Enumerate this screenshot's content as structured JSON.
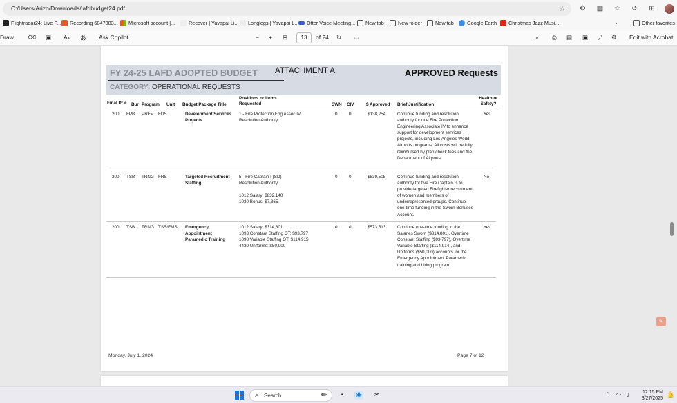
{
  "browser": {
    "url": "C:/Users/Arizo/Downloads/lafdbudget24.pdf",
    "favorites": [
      {
        "label": "Flightradar24: Live F...",
        "color": "#222"
      },
      {
        "label": "Recording 6847083...",
        "color": "#e8562a"
      },
      {
        "label": "Microsoft account |...",
        "color": "#f25022"
      },
      {
        "label": "Recover | Yavapai Li...",
        "color": "#ddd"
      },
      {
        "label": "Longlegs | Yavapai L...",
        "color": "#ddd"
      },
      {
        "label": "Otter Voice Meeting...",
        "color": "#3a5bd9"
      },
      {
        "label": "New tab",
        "color": "#555"
      },
      {
        "label": "New folder",
        "color": "#555"
      },
      {
        "label": "New tab",
        "color": "#555"
      },
      {
        "label": "Google Earth",
        "color": "#3d8ee6"
      },
      {
        "label": "Christmas Jazz Musi...",
        "color": "#e62117"
      }
    ],
    "other_favorites": "Other favorites"
  },
  "pdf_toolbar": {
    "draw": "Draw",
    "ask_copilot": "Ask Copilot",
    "page_current": "13",
    "page_total": "of 24",
    "edit_with_acrobat": "Edit with Acrobat"
  },
  "document": {
    "title": "FY 24-25 LAFD ADOPTED BUDGET",
    "attachment": "ATTACHMENT A",
    "status_heading": "APPROVED Requests",
    "category_label": "CATEGORY:",
    "category_value": "OPERATIONAL REQUESTS",
    "columns": {
      "final_pr": "Final Pr #",
      "bur": "Bur",
      "program": "Program",
      "unit": "Unit",
      "title": "Budget Package Title",
      "positions": "Positions or Items Requested",
      "swn": "SWN",
      "civ": "CIV",
      "approved": "$ Approved",
      "justification": "Brief Justification",
      "health": "Health or Safety?"
    },
    "rows": [
      {
        "final_pr": "200",
        "bur": "FPB",
        "program": "PREV",
        "unit": "FDS",
        "title": "Development Services Projects",
        "positions": "1 - Fire Protection Eng Assoc IV\nResolution Authority",
        "swn": "0",
        "civ": "0",
        "approved": "$138,254",
        "justification": "Continue funding and resolution authority for one Fire Protection Engineering Associate IV to enhance support for development services projects, including Los Angeles World Airports programs.  All costs will be fully reimbursed by plan check fees and the Department of Airports.",
        "health": "Yes"
      },
      {
        "final_pr": "200",
        "bur": "TSB",
        "program": "TRNG",
        "unit": "FRS",
        "title": "Targeted Recruitment Staffing",
        "positions": "5 - Fire Captain I (SD)\nResolution Authority\n\n1012 Salary: $832,140\n1030 Bonus: $7,365",
        "swn": "0",
        "civ": "0",
        "approved": "$839,505",
        "justification": "Continue funding and resolution authority for five Fire Captain Is to provide targeted Firefighter recruitment of women and members of underrepresented groups.  Continue one-time funding in the Sworn Bonuses Account.",
        "health": "No"
      },
      {
        "final_pr": "200",
        "bur": "TSB",
        "program": "TRNG",
        "unit": "TSB/EMS",
        "title": "Emergency Appointment Paramedic Training",
        "positions": "1012 Salary: $314,801\n1093 Constant Staffing OT:  $93,797\n1098 Variable Staffing OT: $114,915\n4430 Uniforms: $50,000",
        "swn": "0",
        "civ": "0",
        "approved": "$573,513",
        "justification": "Continue one-time funding in the Salaries Sworn ($314,801), Overtime Constant Staffing ($93,797), Overtime Variable Staffing ($114,914), and Uniforms ($50,000) accounts for the Emergency Appointment Paramedic training and hiring program.",
        "health": "Yes"
      }
    ],
    "footer_date": "Monday, July 1, 2024",
    "footer_page": "Page 7 of 12"
  },
  "taskbar": {
    "search_placeholder": "Search",
    "time": "12:15 PM",
    "date": "3/27/2025"
  }
}
